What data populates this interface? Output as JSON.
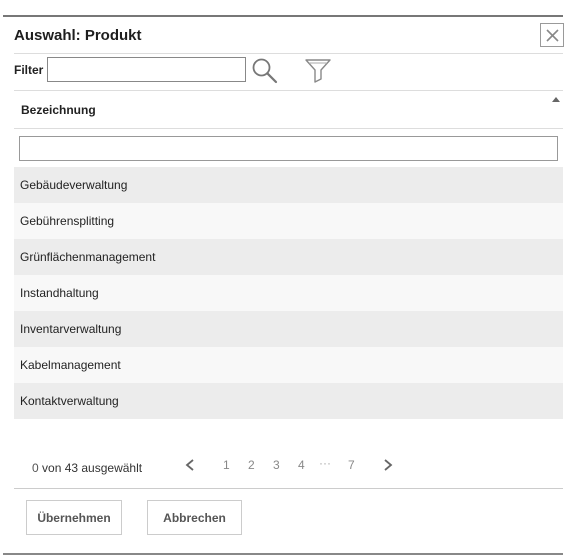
{
  "dialog": {
    "title": "Auswahl: Produkt",
    "close_icon": "close-icon"
  },
  "filter": {
    "label": "Filter",
    "value": "",
    "search_icon": "search-icon",
    "funnel_icon": "filter-funnel-icon"
  },
  "table": {
    "column_header": "Bezeichnung",
    "sort_icon": "sort-ascending-icon",
    "column_filter_value": "",
    "rows": [
      "Gebäudeverwaltung",
      "Gebührensplitting",
      "Grünflächenmanagement",
      "Instandhaltung",
      "Inventarverwaltung",
      "Kabelmanagement",
      "Kontaktverwaltung"
    ]
  },
  "pagination": {
    "selected_count": "0",
    "count_suffix": " von 43 ausgewählt",
    "prev_icon": "chevron-left-icon",
    "next_icon": "chevron-right-icon",
    "pages": [
      "1",
      "2",
      "3",
      "4"
    ],
    "ellipsis": "···",
    "last_page": "7"
  },
  "buttons": {
    "apply_label": "Übernehmen",
    "cancel_label": "Abbrechen"
  }
}
